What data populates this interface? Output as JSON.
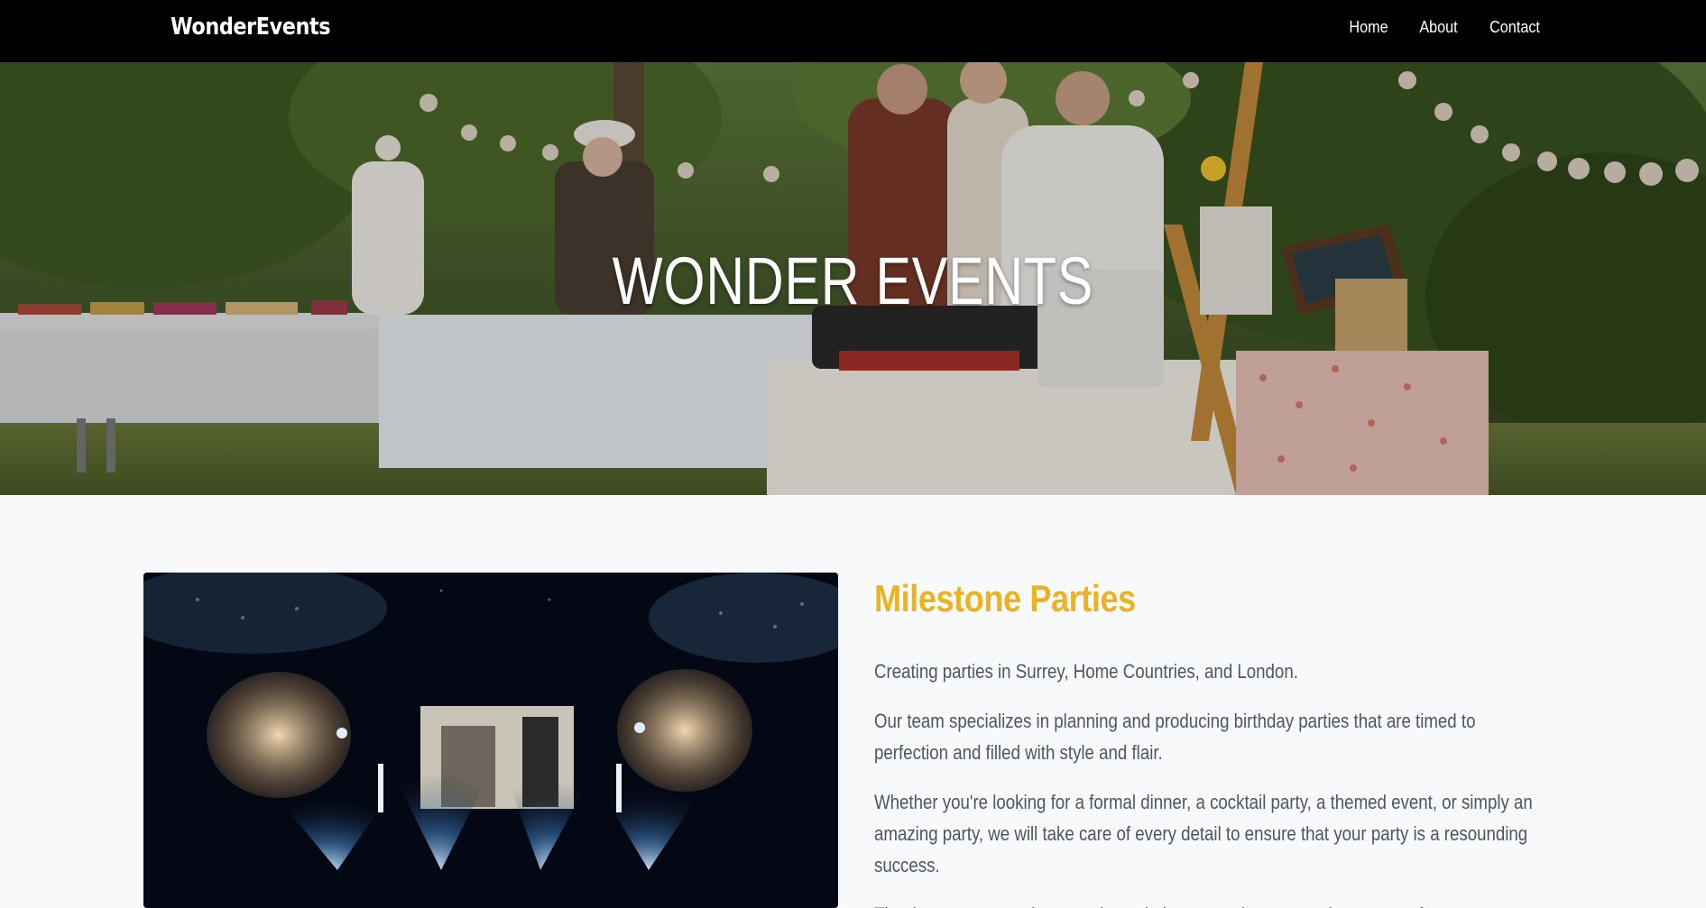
{
  "navbar": {
    "brand": "WonderEvents",
    "links": [
      "Home",
      "About",
      "Contact"
    ]
  },
  "hero": {
    "title": "WONDER EVENTS",
    "image": "outdoor-garden-market-photo"
  },
  "feature": {
    "image": "stage-lighting-event-photo",
    "title": "Milestone Parties",
    "paragraphs": [
      "Creating parties in Surrey, Home Countries, and London.",
      "Our team specializes in planning and producing birthday parties that are timed to perfection and filled with style and flair.",
      "Whether you're looking for a formal dinner, a cocktail party, a themed event, or simply an amazing party, we will take care of every detail to ensure that your party is a resounding success.",
      "Thanks to our extensive experience in luxury parties, we produce events for every"
    ]
  },
  "colors": {
    "navbar_bg": "#000000",
    "accent": "#ecb220",
    "body_text": "#4f5661",
    "page_bg": "#f8f9fb"
  }
}
